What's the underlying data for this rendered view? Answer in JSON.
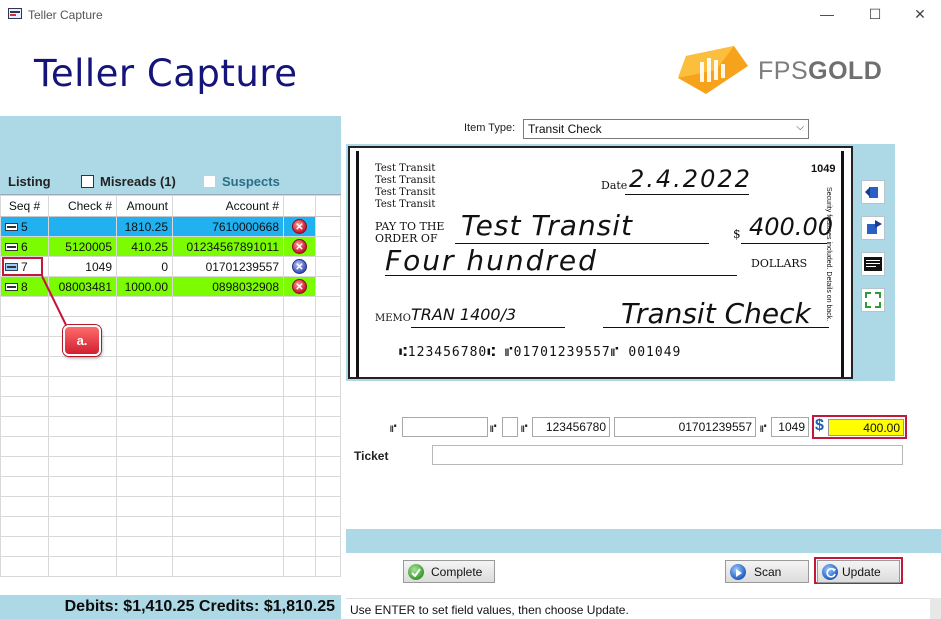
{
  "window": {
    "title": "Teller Capture",
    "min_glyph": "—",
    "max_glyph": "☐",
    "close_glyph": "✕"
  },
  "header": {
    "heading": "Teller Capture",
    "logo_text_light": "FPS",
    "logo_text_bold": "GOLD",
    "logo_color": "#f7a21b"
  },
  "left_panel": {
    "tabs": {
      "listing": "Listing",
      "misreads": "Misreads (1)",
      "suspects": "Suspects"
    },
    "columns": [
      "Seq #",
      "Check #",
      "Amount",
      "Account #"
    ],
    "rows": [
      {
        "seq": "5",
        "check": "",
        "amount": "1810.25",
        "account": "7610000668",
        "style": "blue",
        "icon": "deposit-icon"
      },
      {
        "seq": "6",
        "check": "5120005",
        "amount": "410.25",
        "account": "01234567891011",
        "style": "green",
        "icon": "deposit-icon"
      },
      {
        "seq": "7",
        "check": "1049",
        "amount": "0",
        "account": "01701239557",
        "style": "white",
        "icon": "flag-icon"
      },
      {
        "seq": "8",
        "check": "08003481",
        "amount": "1000.00",
        "account": "0898032908",
        "style": "green",
        "icon": "deposit-icon"
      }
    ],
    "callout": "a.",
    "totals": "Debits: $1,410.25 Credits: $1,810.25"
  },
  "item_type": {
    "label": "Item Type:",
    "value": "Transit Check"
  },
  "check_image": {
    "payer_lines": [
      "Test Transit",
      "Test Transit",
      "Test Transit",
      "Test Transit"
    ],
    "check_number": "1049",
    "date_label": "Date",
    "date_value": "2.4.2022",
    "pay_to_label_1": "PAY TO THE",
    "pay_to_label_2": "ORDER OF",
    "payee": "Test Transit",
    "dollar_sign": "$",
    "amount_numeric": "400.00",
    "amount_words": "Four hundred",
    "dollars_label": "DOLLARS",
    "memo_label": "MEMO",
    "memo_value": "TRAN 1400/3",
    "signature": "Transit Check",
    "micr_line": "⑆123456780⑆ ⑈01701239557⑈ 001049",
    "security_note": "Security features included. Details on back."
  },
  "micr_fields": {
    "aux_onus": "",
    "epc": "",
    "routing": "123456780",
    "account": "01701239557",
    "serial": "1049",
    "amount": "400.00",
    "currency_symbol": "$",
    "micr_symbol": "⑈"
  },
  "ticket": {
    "label": "Ticket",
    "value": ""
  },
  "buttons": {
    "complete": "Complete",
    "scan": "Scan",
    "update": "Update"
  },
  "status": "Use ENTER to set field values, then choose Update.",
  "colors": {
    "accent_blue": "#add8e6",
    "row_blue": "#21b1f0",
    "row_green": "#7cfc00",
    "highlight_red": "#c2183a",
    "amount_yellow": "#ffff00"
  }
}
